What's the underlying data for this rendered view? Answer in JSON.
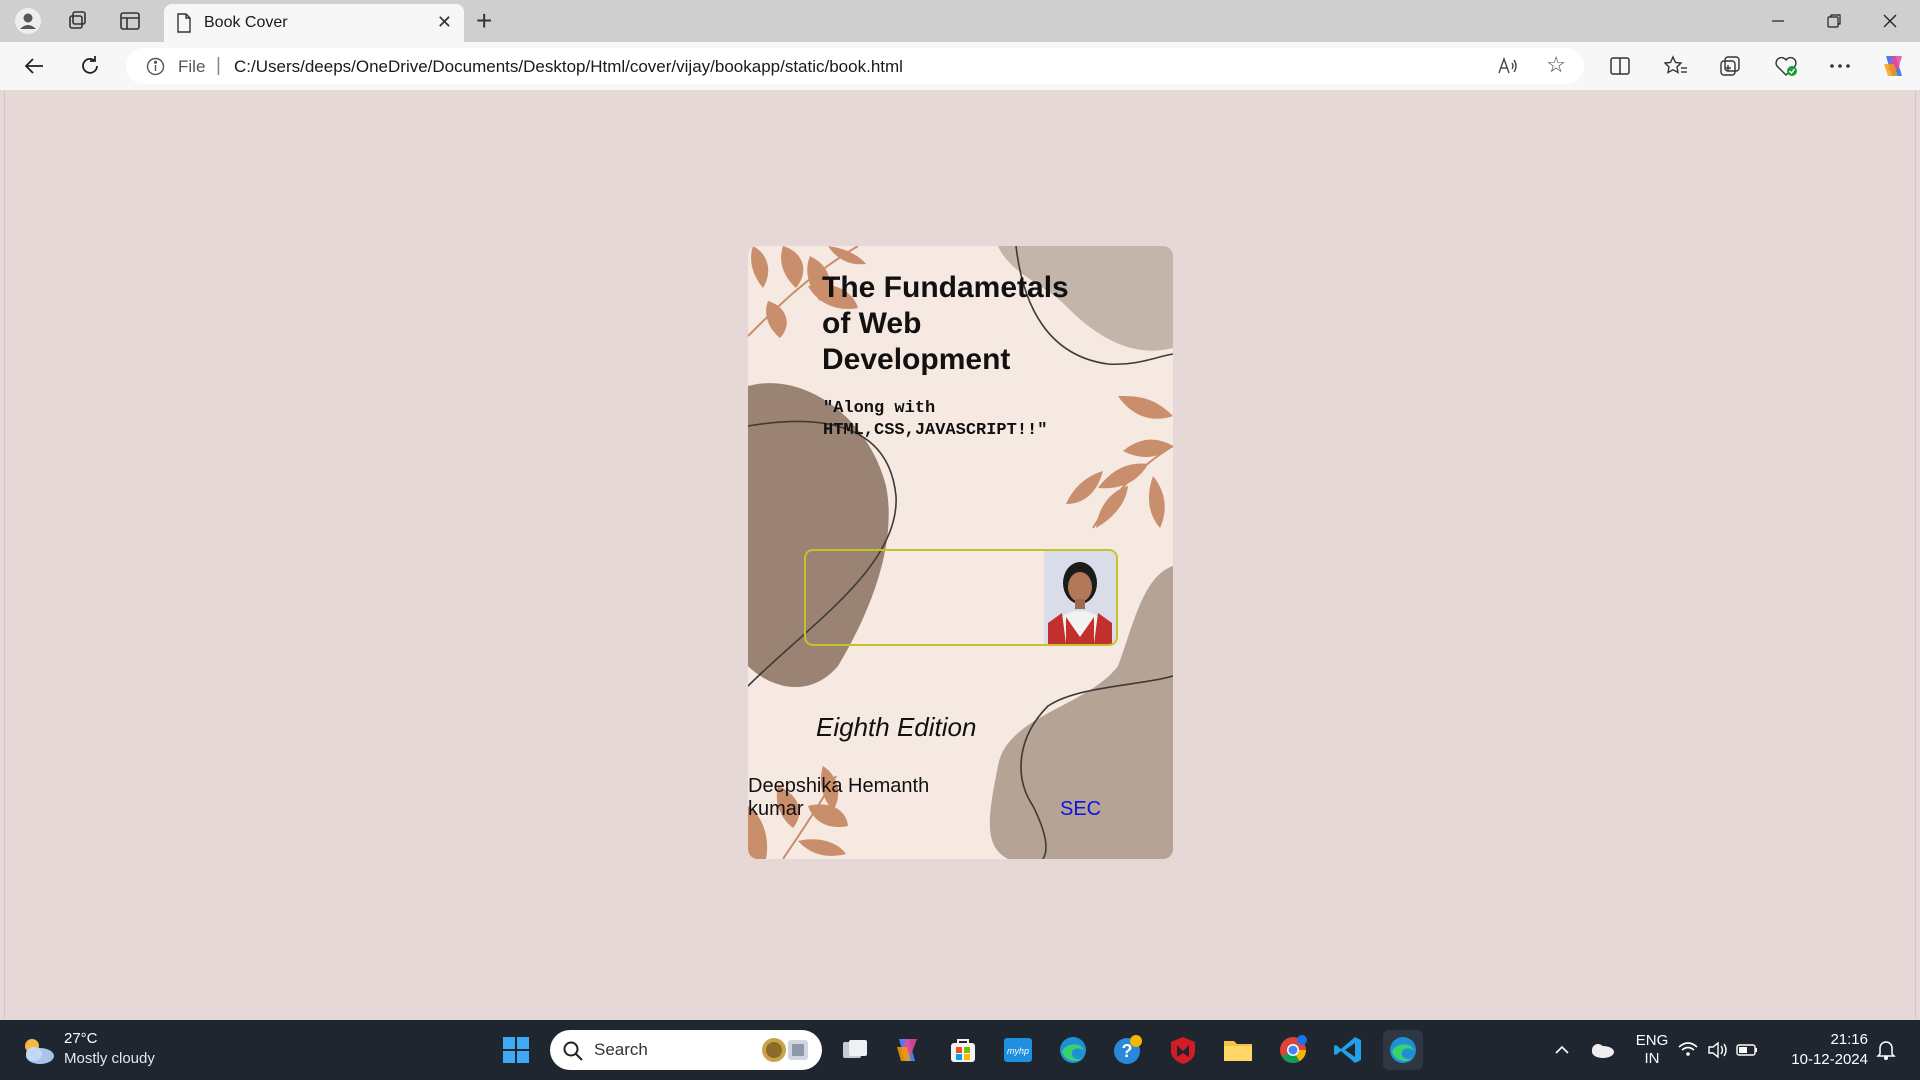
{
  "browser": {
    "tab_title": "Book Cover",
    "address_scheme": "File",
    "address_url": "C:/Users/deeps/OneDrive/Documents/Desktop/Html/cover/vijay/bookapp/static/book.html",
    "read_aloud_label": "A̅"
  },
  "cover": {
    "title": "The Fundametals of Web Development",
    "tagline": "\"Along with HTML,CSS,JAVASCRIPT!!\"",
    "edition": "Eighth Edition",
    "author": "Deepshika Hemanth kumar",
    "publisher": "SEC",
    "colors": {
      "background": "#f6e9e2",
      "leaf": "#c98e6c",
      "blob_dark": "#9b8474",
      "blob_light": "#b9a698",
      "box_border": "#c6c02a",
      "publisher_text": "#1010e0"
    }
  },
  "taskbar": {
    "weather_temp": "27°C",
    "weather_desc": "Mostly cloudy",
    "search_placeholder": "Search",
    "language_line1": "ENG",
    "language_line2": "IN",
    "time": "21:16",
    "date": "10-12-2024"
  }
}
